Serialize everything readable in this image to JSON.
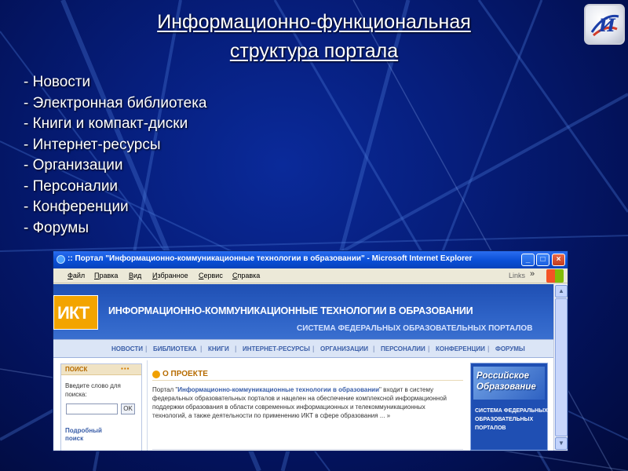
{
  "slide": {
    "title_line1": "Информационно-функциональная",
    "title_line2": "структура портала",
    "bullets": [
      "- Новости",
      "- Электронная библиотека",
      "- Книги и компакт-диски",
      "- Интернет-ресурсы",
      "- Организации",
      "- Персоналии",
      "- Конференции",
      "- Форумы"
    ]
  },
  "browser": {
    "window_title": ":: Портал \"Информационно-коммуникационные технологии в образовании\" - Microsoft Internet Explorer",
    "menu": [
      "Файл",
      "Правка",
      "Вид",
      "Избранное",
      "Сервис",
      "Справка"
    ],
    "links_label": "Links",
    "links_chevron": "»"
  },
  "site": {
    "logo_text": "ИКТ",
    "title": "ИНФОРМАЦИОННО-КОММУНИКАЦИОННЫЕ ТЕХНОЛОГИИ В ОБРАЗОВАНИИ",
    "subtitle": "СИСТЕМА ФЕДЕРАЛЬНЫХ ОБРАЗОВАТЕЛЬНЫХ ПОРТАЛОВ",
    "nav": [
      "НОВОСТИ",
      "БИБЛИОТЕКА",
      "КНИГИ",
      "ИНТЕРНЕТ-РЕСУРСЫ",
      "ОРГАНИЗАЦИИ",
      "ПЕРСОНАЛИИ",
      "КОНФЕРЕНЦИИ",
      "ФОРУМЫ"
    ],
    "search": {
      "heading": "ПОИСК",
      "hint": "Введите слово для поиска:",
      "ok": "OK",
      "advanced": "Подробный поиск"
    },
    "project": {
      "heading": "О ПРОЕКТЕ",
      "text_prefix": "Портал \"",
      "text_bold": "Информационно-коммуникационные технологии в образовании",
      "text_rest": "\" входит в систему федеральных образовательных порталов и нацелен на обеспечение комплексной информационной поддержки образования в области современных информационных и телекоммуникационных технологий, а также деятельности по применению ИКТ в сфере образования ... »"
    },
    "banner": {
      "title": "Российское Образование",
      "subtitle": "СИСТЕМА ФЕДЕРАЛЬНЫХ ОБРАЗОВАТЕЛЬНЫХ ПОРТАЛОВ"
    }
  }
}
